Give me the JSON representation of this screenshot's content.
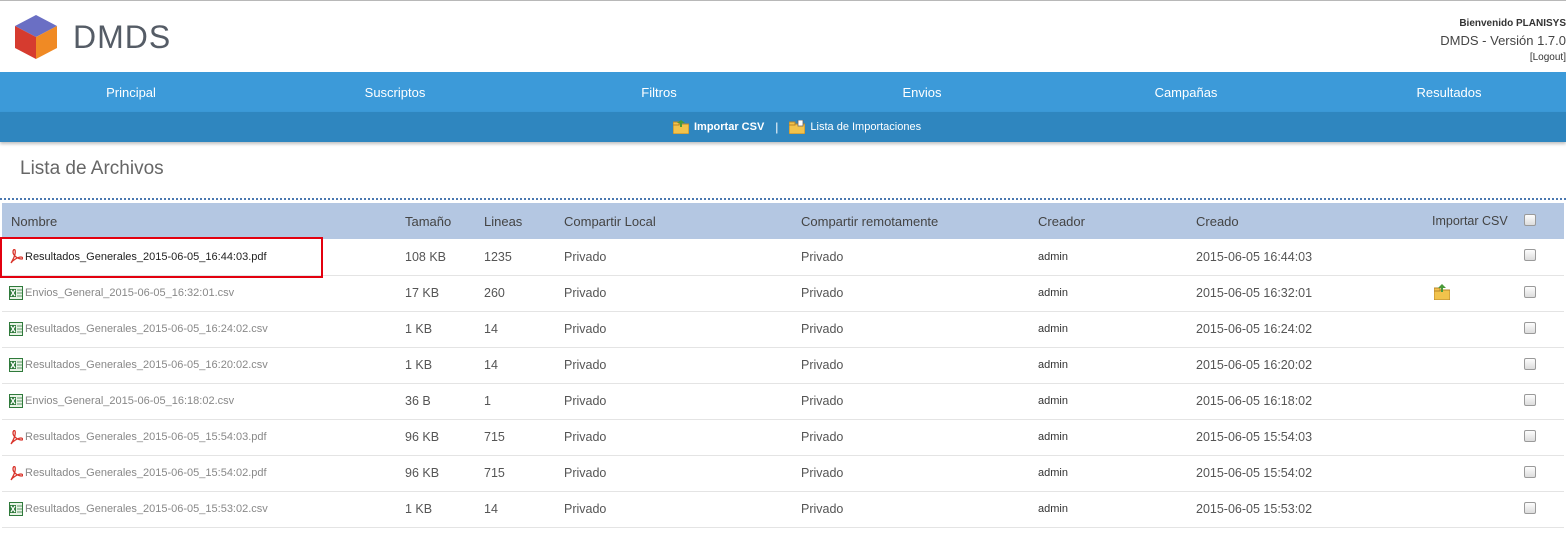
{
  "header": {
    "brand": "DMDS",
    "welcome": "Bienvenido PLANISYS",
    "version": "DMDS - Versión 1.7.0",
    "logout": "[Logout]"
  },
  "nav": {
    "items": [
      "Principal",
      "Suscriptos",
      "Filtros",
      "Envios",
      "Campañas",
      "Resultados"
    ]
  },
  "subnav": {
    "import_csv": "Importar CSV",
    "separator": "|",
    "import_list": "Lista de Importaciones"
  },
  "page": {
    "title": "Lista de Archivos"
  },
  "table": {
    "headers": {
      "name": "Nombre",
      "size": "Tamaño",
      "lines": "Lineas",
      "share_local": "Compartir Local",
      "share_remote": "Compartir remotamente",
      "creator": "Creador",
      "created": "Creado",
      "import_csv": "Importar CSV"
    },
    "rows": [
      {
        "type": "pdf",
        "name": "Resultados_Generales_2015-06-05_16:44:03.pdf",
        "size": "108 KB",
        "lines": "1235",
        "local": "Privado",
        "remote": "Privado",
        "creator": "admin",
        "created": "2015-06-05 16:44:03",
        "import": false
      },
      {
        "type": "csv",
        "name": "Envios_General_2015-06-05_16:32:01.csv",
        "size": "17 KB",
        "lines": "260",
        "local": "Privado",
        "remote": "Privado",
        "creator": "admin",
        "created": "2015-06-05 16:32:01",
        "import": true
      },
      {
        "type": "csv",
        "name": "Resultados_Generales_2015-06-05_16:24:02.csv",
        "size": "1 KB",
        "lines": "14",
        "local": "Privado",
        "remote": "Privado",
        "creator": "admin",
        "created": "2015-06-05 16:24:02",
        "import": false
      },
      {
        "type": "csv",
        "name": "Resultados_Generales_2015-06-05_16:20:02.csv",
        "size": "1 KB",
        "lines": "14",
        "local": "Privado",
        "remote": "Privado",
        "creator": "admin",
        "created": "2015-06-05 16:20:02",
        "import": false
      },
      {
        "type": "csv",
        "name": "Envios_General_2015-06-05_16:18:02.csv",
        "size": "36 B",
        "lines": "1",
        "local": "Privado",
        "remote": "Privado",
        "creator": "admin",
        "created": "2015-06-05 16:18:02",
        "import": false
      },
      {
        "type": "pdf",
        "name": "Resultados_Generales_2015-06-05_15:54:03.pdf",
        "size": "96 KB",
        "lines": "715",
        "local": "Privado",
        "remote": "Privado",
        "creator": "admin",
        "created": "2015-06-05 15:54:03",
        "import": false
      },
      {
        "type": "pdf",
        "name": "Resultados_Generales_2015-06-05_15:54:02.pdf",
        "size": "96 KB",
        "lines": "715",
        "local": "Privado",
        "remote": "Privado",
        "creator": "admin",
        "created": "2015-06-05 15:54:02",
        "import": false
      },
      {
        "type": "csv",
        "name": "Resultados_Generales_2015-06-05_15:53:02.csv",
        "size": "1 KB",
        "lines": "14",
        "local": "Privado",
        "remote": "Privado",
        "creator": "admin",
        "created": "2015-06-05 15:53:02",
        "import": false
      }
    ]
  },
  "colors": {
    "nav": "#3c9ad9",
    "subnav": "#2f86bf",
    "table_header": "#b4c7e2",
    "highlight": "#e3000f"
  }
}
